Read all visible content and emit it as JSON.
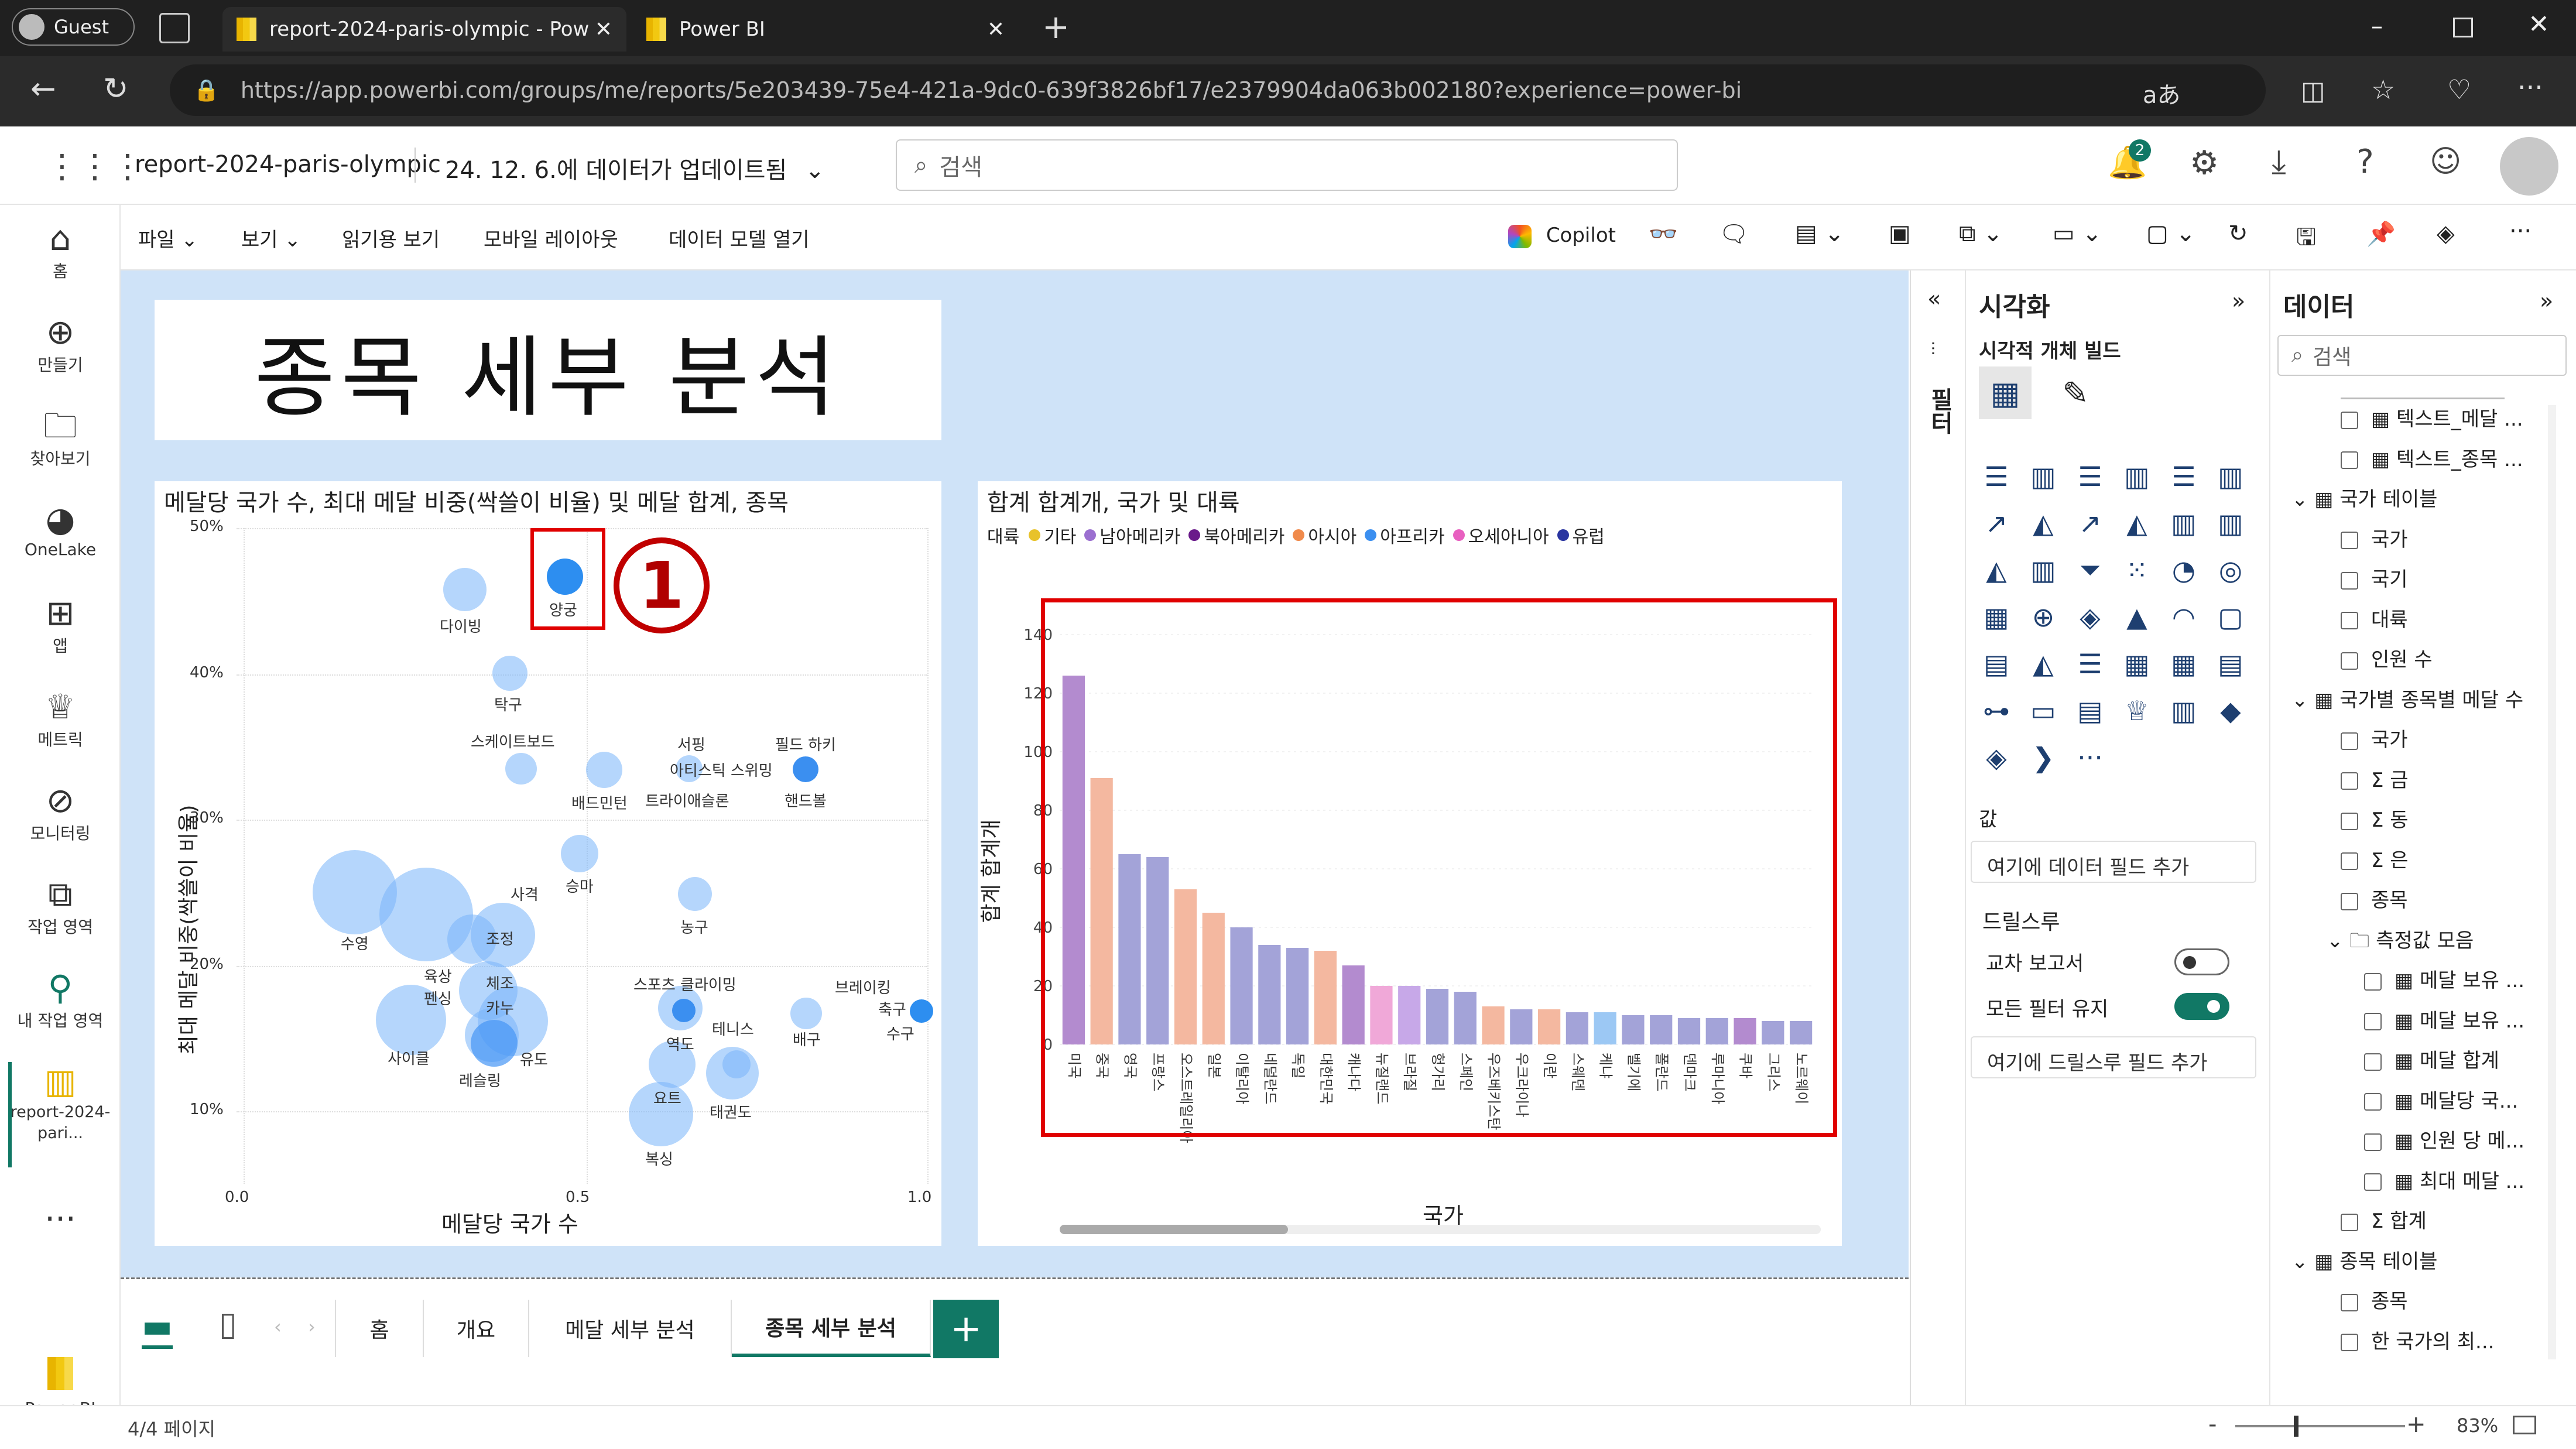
{
  "browser": {
    "profile_label": "Guest",
    "tabs": [
      {
        "label": "report-2024-paris-olympic - Pow"
      },
      {
        "label": "Power BI"
      }
    ],
    "url": "https://app.powerbi.com/groups/me/reports/5e203439-75e4-421a-9dc0-639f3826bf17/e2379904da063b002180?experience=power-bi"
  },
  "app": {
    "report_name": "report-2024-paris-olympic",
    "updated_text": "24. 12. 6.에 데이터가 업데이트됨",
    "search_placeholder": "검색",
    "notification_count": "2"
  },
  "left_rail": [
    {
      "label": "홈"
    },
    {
      "label": "만들기"
    },
    {
      "label": "찾아보기"
    },
    {
      "label": "OneLake"
    },
    {
      "label": "앱"
    },
    {
      "label": "메트릭"
    },
    {
      "label": "모니터링"
    },
    {
      "label": "작업 영역"
    },
    {
      "label": "내 작업 영역"
    },
    {
      "label": "report-2024-pari..."
    },
    {
      "label": "Power BI"
    }
  ],
  "ribbon": {
    "file": "파일",
    "view": "보기",
    "reading_view": "읽기용 보기",
    "mobile_layout": "모바일 레이아웃",
    "open_data_model": "데이터 모델 열기",
    "copilot": "Copilot"
  },
  "page_title": "종목 세부 분석",
  "annotation_number": "1",
  "scatter": {
    "title": "메달당 국가 수, 최대 메달 비중(싹쓸이 비율) 및 메달 합계, 종목",
    "xlabel": "메달당 국가 수",
    "ylabel": "최대 메달 비중(싹쓸이 비율)",
    "x_ticks": [
      "0.0",
      "0.5",
      "1.0"
    ],
    "y_ticks": [
      "50%",
      "40%",
      "30%",
      "20%",
      "10%"
    ],
    "labels": [
      "다이빙",
      "양궁",
      "탁구",
      "스케이트보드",
      "서핑",
      "필드 하키",
      "아티스틱 스위밍",
      "배드민턴",
      "트라이애슬론",
      "핸드볼",
      "승마",
      "사격",
      "농구",
      "수영",
      "조정",
      "육상",
      "펜싱",
      "체조",
      "카누",
      "사이클",
      "레슬링",
      "유도",
      "스포츠 클라이밍",
      "브레이킹",
      "축구",
      "수구",
      "테니스",
      "배구",
      "역도",
      "요트",
      "태권도",
      "복싱"
    ]
  },
  "chart_data": {
    "type": "bar",
    "title": "합계 합계개, 국가 및 대륙",
    "xlabel": "국가",
    "ylabel": "합계 합계개",
    "legend_title": "대륙",
    "legend_position": "top-left",
    "ylim": [
      0,
      140
    ],
    "y_ticks": [
      "140",
      "120",
      "100",
      "80",
      "60",
      "40",
      "20",
      "0"
    ],
    "continents": [
      {
        "name": "기타",
        "color": "#e8c22a"
      },
      {
        "name": "남아메리카",
        "color": "#9b6fd0"
      },
      {
        "name": "북아메리카",
        "color": "#6a1a8a"
      },
      {
        "name": "아시아",
        "color": "#f08a4b"
      },
      {
        "name": "아프리카",
        "color": "#3b8ff0"
      },
      {
        "name": "오세아니아",
        "color": "#e860c0"
      },
      {
        "name": "유럽",
        "color": "#2a35a0"
      }
    ],
    "categories": [
      "미국",
      "중국",
      "영국",
      "프랑스",
      "오스트레일리아",
      "일본",
      "이탈리아",
      "네덜란드",
      "독일",
      "대한민국",
      "캐나다",
      "뉴질랜드",
      "브라질",
      "헝가리",
      "스페인",
      "우즈베키스탄",
      "우크라이나",
      "이란",
      "스웨덴",
      "케냐",
      "벨기에",
      "폴란드",
      "덴마크",
      "루마니아",
      "쿠바",
      "그리스",
      "노르웨이"
    ],
    "values": [
      126,
      91,
      65,
      64,
      53,
      45,
      40,
      34,
      33,
      32,
      27,
      20,
      20,
      19,
      18,
      13,
      12,
      12,
      11,
      11,
      10,
      10,
      9,
      9,
      9,
      8,
      8
    ],
    "bar_colors": [
      "#b38bcf",
      "#f4b8a0",
      "#a3a3d8",
      "#a3a3d8",
      "#f4b8a0",
      "#f4b8a0",
      "#a3a3d8",
      "#a3a3d8",
      "#a3a3d8",
      "#f4b8a0",
      "#b38bcf",
      "#f0a8d8",
      "#c7a8e8",
      "#a3a3d8",
      "#a3a3d8",
      "#f4b8a0",
      "#a3a3d8",
      "#f4b8a0",
      "#a3a3d8",
      "#9cc8f4",
      "#a3a3d8",
      "#a3a3d8",
      "#a3a3d8",
      "#a3a3d8",
      "#b38bcf",
      "#a3a3d8",
      "#a3a3d8"
    ]
  },
  "viz_pane": {
    "title": "시각화",
    "build_label": "시각적 개체 빌드",
    "values_label": "값",
    "values_placeholder": "여기에 데이터 필드 추가",
    "drillthrough_label": "드릴스루",
    "cross_report": "교차 보고서",
    "keep_filters": "모든 필터 유지",
    "drill_placeholder": "여기에 드릴스루 필드 추가",
    "filters_label": "필터"
  },
  "data_pane": {
    "title": "데이터",
    "search_placeholder": "검색",
    "items": [
      {
        "label": "텍스트_메달 ...",
        "type": "measure"
      },
      {
        "label": "텍스트_종목 ...",
        "type": "measure"
      },
      {
        "label": "국가 테이블",
        "type": "table"
      },
      {
        "label": "국가",
        "type": "field"
      },
      {
        "label": "국기",
        "type": "field"
      },
      {
        "label": "대륙",
        "type": "field"
      },
      {
        "label": "인원 수",
        "type": "field"
      },
      {
        "label": "국가별 종목별 메달 수",
        "type": "table"
      },
      {
        "label": "국가",
        "type": "field"
      },
      {
        "label": "금",
        "type": "sum"
      },
      {
        "label": "동",
        "type": "sum"
      },
      {
        "label": "은",
        "type": "sum"
      },
      {
        "label": "종목",
        "type": "field"
      },
      {
        "label": "측정값 모음",
        "type": "folder"
      },
      {
        "label": "메달 보유 ...",
        "type": "measure"
      },
      {
        "label": "메달 보유 ...",
        "type": "measure"
      },
      {
        "label": "메달 합계",
        "type": "measure"
      },
      {
        "label": "메달당 국...",
        "type": "measure"
      },
      {
        "label": "인원 당 메...",
        "type": "measure"
      },
      {
        "label": "최대 메달 ...",
        "type": "measure"
      },
      {
        "label": "합계",
        "type": "sum"
      },
      {
        "label": "종목 테이블",
        "type": "table"
      },
      {
        "label": "종목",
        "type": "field"
      },
      {
        "label": "한 국가의 최...",
        "type": "field"
      }
    ]
  },
  "page_tabs": [
    {
      "label": "홈"
    },
    {
      "label": "개요"
    },
    {
      "label": "메달 세부 분석"
    },
    {
      "label": "종목 세부 분석"
    }
  ],
  "status": {
    "page_indicator": "4/4 페이지",
    "zoom": "83%"
  }
}
